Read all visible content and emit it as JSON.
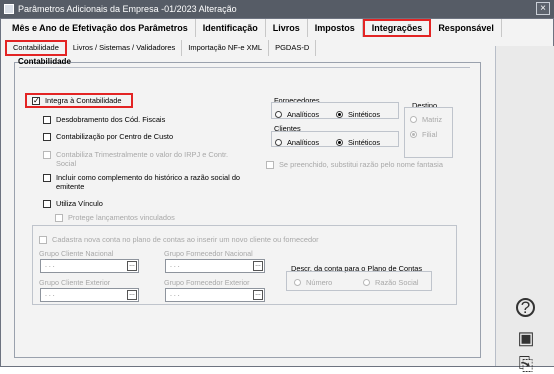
{
  "window": {
    "title": "Parâmetros Adicionais da Empresa -01/2023 Alteração",
    "close_glyph": "×"
  },
  "main_tabs": [
    "Mês e Ano de Efetivação dos Parâmetros",
    "Identificação",
    "Livros",
    "Impostos",
    "Integrações",
    "Responsável"
  ],
  "sub_tabs": [
    "Contabilidade",
    "Livros / Sistemas / Validadores",
    "Importação NF-e XML",
    "PGDAS-D"
  ],
  "contabilidade": {
    "title": "Contabilidade",
    "integra": "Integra à Contabilidade",
    "desdobramento": "Desdobramento dos Cód. Fiscais",
    "centro_custo": "Contabilização por Centro de Custo",
    "trimestral_line1": "Contabiliza Trimestralmente o valor do IRPJ e Contr.",
    "trimestral_line2": "Social",
    "historico_line1": "Incluir como complemento do histórico a razão social do",
    "historico_line2": "emitente",
    "vinculo": "Utiliza Vínculo",
    "protege": "Protege lançamentos vinculados"
  },
  "fornecedores": {
    "label": "Fornecedores",
    "analiticos": "Analíticos",
    "sinteticos": "Sintéticos"
  },
  "clientes": {
    "label": "Clientes",
    "analiticos": "Analíticos",
    "sinteticos": "Sintéticos"
  },
  "destino": {
    "label": "Destino",
    "matriz": "Matriz",
    "filial": "Filial"
  },
  "fantasia": "Se preenchido, substitui razão pelo nome fantasia",
  "cadastro": {
    "label": "Cadastra nova conta no plano de contas ao inserir um novo cliente ou fornecedor",
    "grupo_cliente_nacional": "Grupo Cliente Nacional",
    "grupo_fornecedor_nacional": "Grupo Fornecedor Nacional",
    "grupo_cliente_exterior": "Grupo Cliente Exterior",
    "grupo_fornecedor_exterior": "Grupo Fornecedor Exterior",
    "descr_label": "Descr. da conta para o Plano de Contas",
    "numero": "Número",
    "razao_social": "Razão Social",
    "field_value": ". . .",
    "lookup_glyph": "…"
  },
  "sidebar": {
    "help_glyph": "?",
    "save_glyph": "▣",
    "export_glyph": "⎘"
  }
}
